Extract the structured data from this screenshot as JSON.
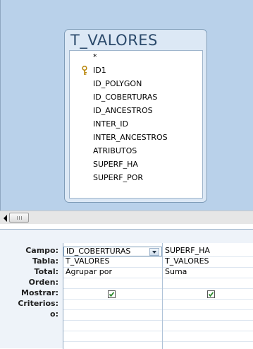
{
  "table": {
    "title": "T_VALORES",
    "fields": [
      "*",
      "ID1",
      "ID_POLYGON",
      "ID_COBERTURAS",
      "ID_ANCESTROS",
      "INTER_ID",
      "INTER_ANCESTROS",
      "ATRIBUTOS",
      "SUPERF_HA",
      "SUPERF_POR"
    ],
    "key_field": "ID1"
  },
  "grid": {
    "row_labels": [
      "Campo:",
      "Tabla:",
      "Total:",
      "Orden:",
      "Mostrar:",
      "Criterios:",
      "o:"
    ],
    "columns": [
      {
        "field": "ID_COBERTURAS",
        "table": "T_VALORES",
        "total": "Agrupar por",
        "sort": "",
        "show": true,
        "criteria": "",
        "or": ""
      },
      {
        "field": "SUPERF_HA",
        "table": "T_VALORES",
        "total": "Suma",
        "sort": "",
        "show": true,
        "criteria": "",
        "or": ""
      }
    ]
  },
  "icons": [
    "key-icon",
    "scroll-left-icon",
    "dropdown-arrow-icon",
    "checkbox-checked-icon"
  ],
  "colors": {
    "designer_bg": "#b9d1ea",
    "table_header": "#dce8f5",
    "grid_bg": "#eef3f9",
    "check": "#2d8a2d"
  }
}
